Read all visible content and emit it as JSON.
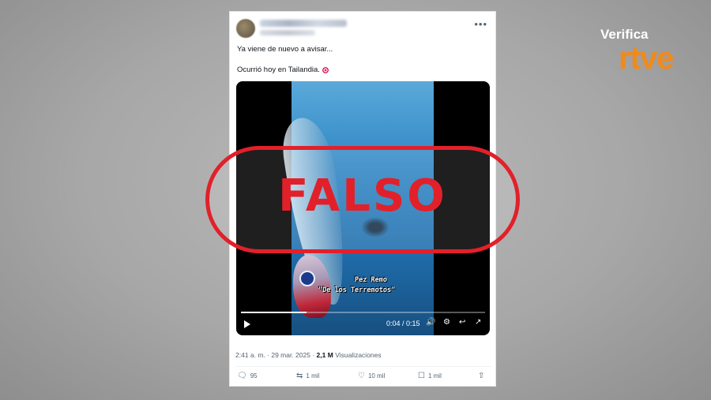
{
  "tweet": {
    "line1": "Ya viene de nuevo a avisar...",
    "line2": "Ocurrió hoy en Tailandia.",
    "line2_icon": "target-icon",
    "more_icon": "more-horizontal-icon",
    "caption_line1": "Pez Remo",
    "caption_line2": "\"De los Terremotos\"",
    "video_time": "0:04 / 0:15",
    "video_progress": 0.27,
    "timestamp": "2:41 a. m. · 29 mar. 2025 ·",
    "views_count": "2,1 M",
    "views_label": "Visualizaciones",
    "actions": {
      "replies": "95",
      "reposts": "1 mil",
      "likes": "10 mil",
      "bookmarks": "1 mil"
    }
  },
  "overlay": {
    "stamp_text": "FALSO",
    "stamp_color": "#e2202a"
  },
  "brand": {
    "top": "Verifica",
    "bottom": "rtve",
    "color": "#f08a1c"
  }
}
